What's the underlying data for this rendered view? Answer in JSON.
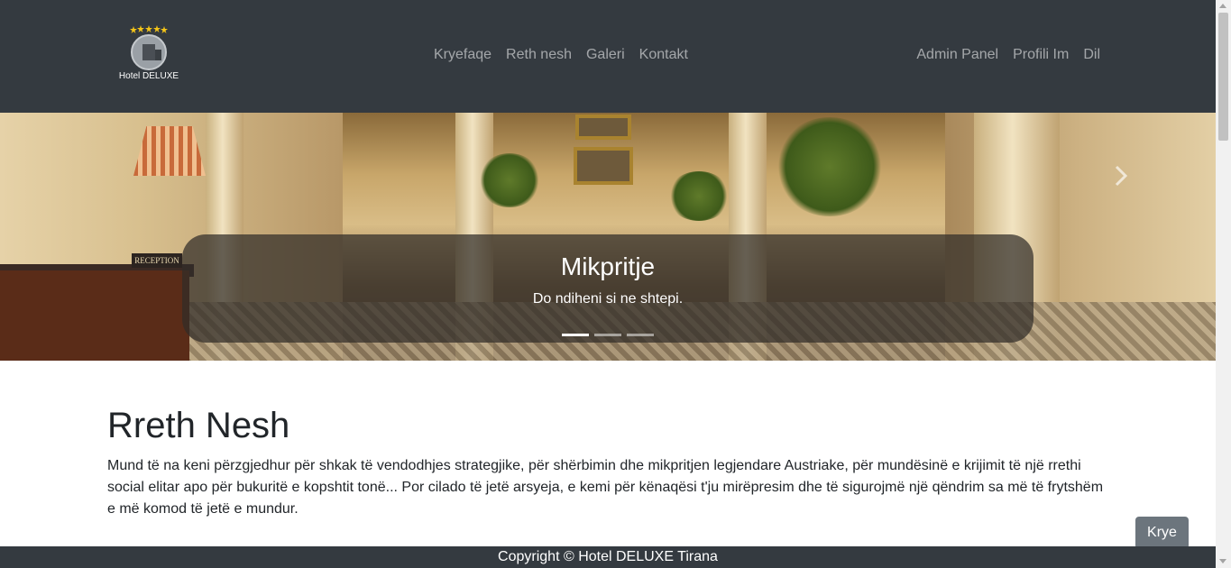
{
  "brand": {
    "logo_text": "Hotel DELUXE",
    "stars": "★★★★★",
    "logo_icon": "hotel-building-icon"
  },
  "nav": {
    "left": [
      "Kryefaqe",
      "Reth nesh",
      "Galeri",
      "Kontakt"
    ],
    "right": [
      "Admin Panel",
      "Profili Im",
      "Dil"
    ]
  },
  "carousel": {
    "title": "Mikpritje",
    "subtitle": "Do ndiheni si ne shtepi.",
    "reception_sign": "RECEPTION",
    "slide_count": 3,
    "active_slide": 1,
    "next_icon": "chevron-right-icon"
  },
  "about": {
    "heading": "Rreth Nesh",
    "text": "Mund të na keni përzgjedhur për shkak të vendodhjes strategjike, për shërbimin dhe mikpritjen legjendare Austriake, për mundësinë e krijimit të një rrethi social elitar apo për bukuritë e kopshtit tonë... Por cilado të jetë arsyeja, e kemi për kënaqësi t'ju mirëpresim dhe të sigurojmë një qëndrim sa më të frytshëm e më komod të jetë e mundur."
  },
  "back_to_top": "Krye",
  "footer": {
    "text": "Copyright © Hotel DELUXE Tirana"
  },
  "colors": {
    "navbar": "#343a40",
    "footer": "#343a40",
    "button": "#6c757d",
    "star": "#f5c518"
  }
}
